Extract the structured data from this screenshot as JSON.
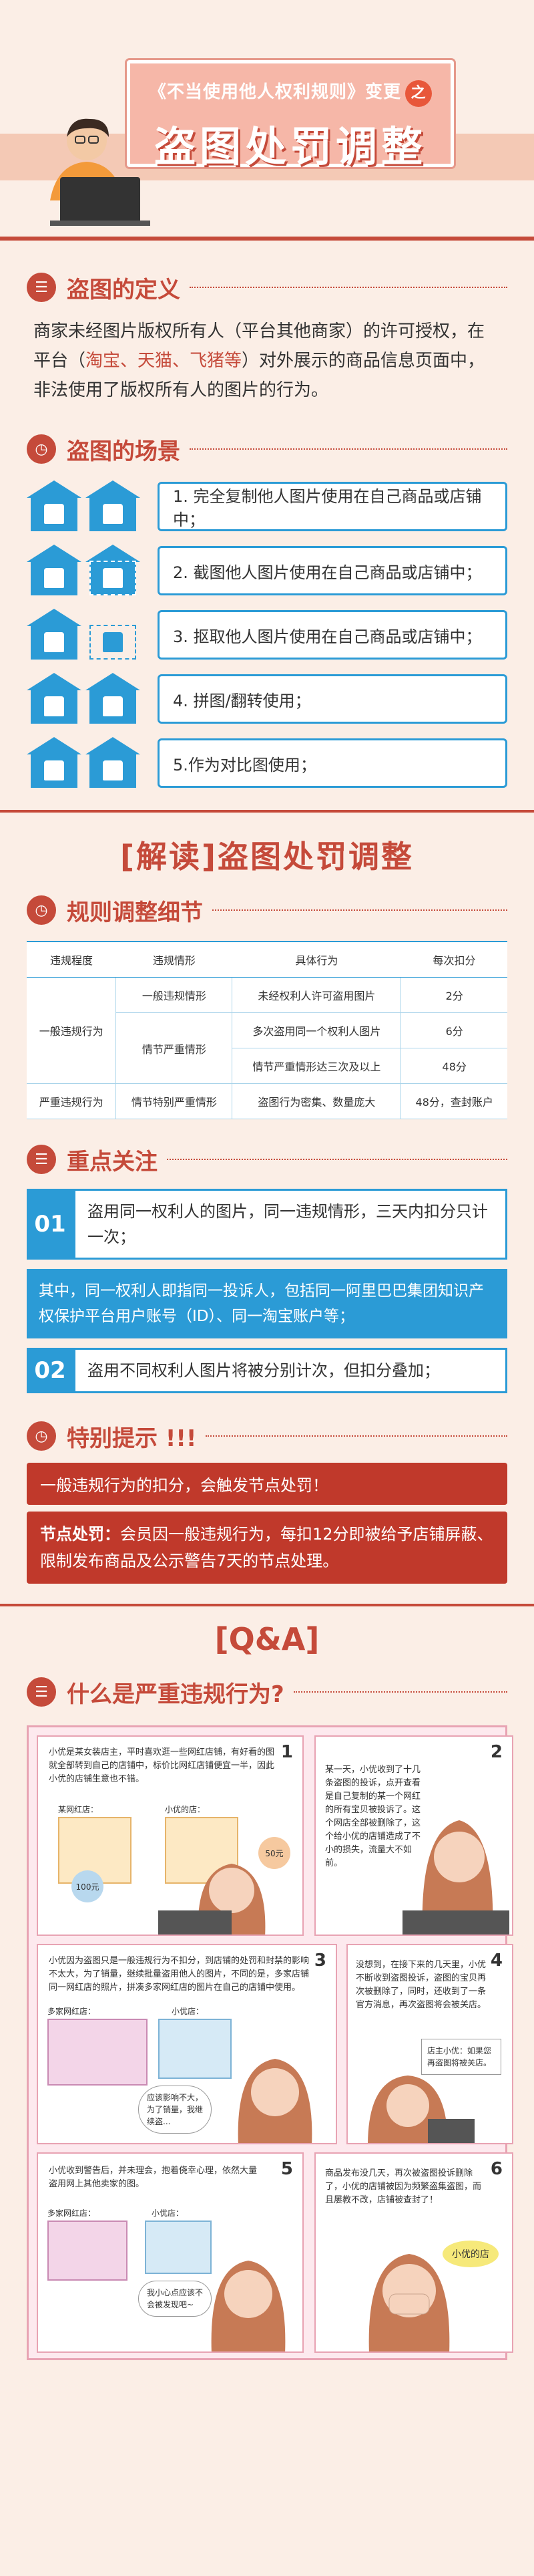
{
  "hero": {
    "subtitle": "《不当使用他人权利规则》变更",
    "subtitle_mark": "之",
    "title": "盗图处罚调整"
  },
  "definition": {
    "heading": "盗图的定义",
    "text_before": "商家未经图片版权所有人（平台其他商家）的许可授权，在平台（",
    "platforms": "淘宝、天猫、飞猪等",
    "text_after": "）对外展示的商品信息页面中，非法使用了版权所有人的图片的行为。"
  },
  "scenes": {
    "heading": "盗图的场景",
    "items": [
      "1. 完全复制他人图片使用在自己商品或店铺中；",
      "2. 截图他人图片使用在自己商品或店铺中；",
      "3. 抠取他人图片使用在自己商品或店铺中；",
      "4. 拼图/翻转使用；",
      "5.作为对比图使用；"
    ]
  },
  "interpret": {
    "title": "[解读]盗图处罚调整"
  },
  "rules": {
    "heading": "规则调整细节",
    "headers": [
      "违规程度",
      "违规情形",
      "具体行为",
      "每次扣分"
    ],
    "general_level": "一般违规行为",
    "serious_level": "严重违规行为",
    "rows": [
      {
        "case": "一般违规情形",
        "act": "未经权利人许可盗用图片",
        "points": "2分"
      },
      {
        "case": "情节严重情形",
        "act": "多次盗用同一个权利人图片",
        "points": "6分"
      },
      {
        "case": "",
        "act": "情节严重情形达三次及以上",
        "points": "48分"
      },
      {
        "case": "情节特别严重情形",
        "act": "盗图行为密集、数量庞大",
        "points": "48分，查封账户"
      }
    ]
  },
  "focus": {
    "heading": "重点关注",
    "item1_num": "01",
    "item1": "盗用同一权利人的图片，同一违规情形，三天内扣分只计一次；",
    "item1_detail": "其中，同一权利人即指同一投诉人，包括同一阿里巴巴集团知识产权保护平台用户账号（ID）、同一淘宝账户等；",
    "item2_num": "02",
    "item2": "盗用不同权利人图片将被分别计次，但扣分叠加；"
  },
  "notice": {
    "heading": "特别提示 !!!",
    "line1": "一般违规行为的扣分，会触发节点处罚！",
    "node_label": "节点处罚：",
    "node_text": "会员因一般违规行为，每扣12分即被给予店铺屏蔽、限制发布商品及公示警告7天的节点处理。"
  },
  "qa": {
    "title": "[Q&A]",
    "heading": "什么是严重违规行为?",
    "panels": [
      {
        "num": "1",
        "text": "小优是某女装店主，平时喜欢逛一些网红店铺，有好看的图就全部转到自己的店铺中，标价比网红店铺便宜一半，因此小优的店铺生意也不错。"
      },
      {
        "num": "2",
        "text": "某一天，小优收到了十几条盗图的投诉，点开查看是自己复制的某一个网红的所有宝贝被投诉了。这个网店全部被删除了，这个给小优的店铺造成了不小的损失，流量大不如前。"
      },
      {
        "num": "3",
        "text": "小优因为盗图只是一般违规行为不扣分，到店铺的处罚和封禁的影响不太大，为了销量，继续批量盗用他人的图片，不同的是，多家店铺同一网红店的照片，拼凑多家网红店的图片在自己的店铺中使用。"
      },
      {
        "num": "4",
        "text": "没想到，在接下来的几天里，小优不断收到盗图投诉，盗图的宝贝再次被删除了，同时，还收到了一条官方消息，再次盗图将会被关店。"
      },
      {
        "num": "5",
        "text": "小优收到警告后，并未理会，抱着侥幸心理，依然大量盗用网上其他卖家的图。"
      },
      {
        "num": "6",
        "text": "商品发布没几天，再次被盗图投诉删除了，小优的店铺被因为频繁盗集盗图，而且屡教不改，店铺被查封了！"
      }
    ],
    "labels": {
      "shop1": "某网红店：",
      "shop2": "小优的店：",
      "price1": "100元",
      "price2": "50元",
      "shop3": "多家网红店：",
      "shop4": "小优店：",
      "bubble3": "应该影响不大，为了销量，我继续盗...",
      "bubble4": "店主小优：如果您再盗图将被关店。",
      "shop5": "多家网红店：",
      "shop6": "小优店：",
      "bubble5": "我小心点应该不会被发现吧~",
      "shop_badge": "小优的店"
    }
  },
  "colors": {
    "accent_red": "#c54a3a",
    "accent_blue": "#2b9bd6",
    "background": "#fbeee6"
  }
}
